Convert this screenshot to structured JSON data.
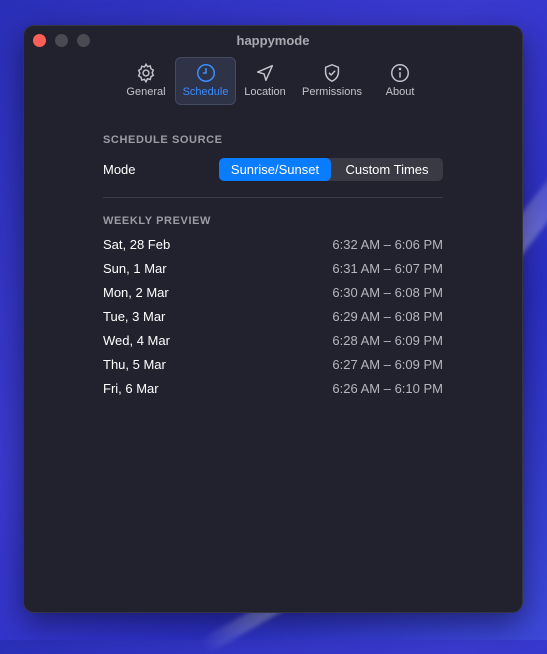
{
  "app": {
    "title": "happymode"
  },
  "toolbar": {
    "tabs": [
      {
        "label": "General",
        "icon": "gear-icon"
      },
      {
        "label": "Schedule",
        "icon": "clock-icon",
        "active": true
      },
      {
        "label": "Location",
        "icon": "location-arrow-icon"
      },
      {
        "label": "Permissions",
        "icon": "shield-check-icon"
      },
      {
        "label": "About",
        "icon": "info-icon"
      }
    ]
  },
  "schedule_source": {
    "heading": "SCHEDULE SOURCE",
    "mode_label": "Mode",
    "options": [
      "Sunrise/Sunset",
      "Custom Times"
    ],
    "selected": "Sunrise/Sunset"
  },
  "weekly_preview": {
    "heading": "WEEKLY PREVIEW",
    "rows": [
      {
        "date": "Sat, 28 Feb",
        "time": "6:32 AM – 6:06 PM"
      },
      {
        "date": "Sun, 1 Mar",
        "time": "6:31 AM – 6:07 PM"
      },
      {
        "date": "Mon, 2 Mar",
        "time": "6:30 AM – 6:08 PM"
      },
      {
        "date": "Tue, 3 Mar",
        "time": "6:29 AM – 6:08 PM"
      },
      {
        "date": "Wed, 4 Mar",
        "time": "6:28 AM – 6:09 PM"
      },
      {
        "date": "Thu, 5 Mar",
        "time": "6:27 AM – 6:09 PM"
      },
      {
        "date": "Fri, 6 Mar",
        "time": "6:26 AM – 6:10 PM"
      }
    ]
  },
  "colors": {
    "accent": "#0a7cff",
    "window_bg": "#22222e",
    "close": "#ff5f57"
  }
}
